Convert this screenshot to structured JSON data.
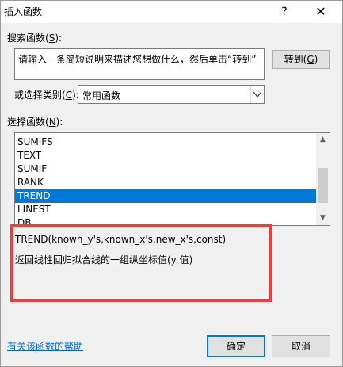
{
  "window": {
    "title": "插入函数",
    "help_icon": "question-mark-icon",
    "close_icon": "close-icon"
  },
  "search": {
    "label_prefix": "搜索函数(",
    "label_key": "S",
    "label_suffix": "):",
    "value": "请输入一条简短说明来描述您想做什么，然后单击“转到”",
    "go_prefix": "转到(",
    "go_key": "G",
    "go_suffix": ")"
  },
  "category": {
    "label_prefix": "或选择类别(",
    "label_key": "C",
    "label_suffix": "):",
    "selected": "常用函数",
    "arrow_icon": "chevron-down-icon"
  },
  "functions": {
    "label_prefix": "选择函数(",
    "label_key": "N",
    "label_suffix": "):",
    "items": [
      "SUMIFS",
      "TEXT",
      "SUMIF",
      "RANK",
      "TREND",
      "LINEST",
      "DB"
    ],
    "selected_index": 4
  },
  "description": {
    "syntax": "TREND(known_y's,known_x's,new_x's,const)",
    "text": "返回线性回归拟合线的一组纵坐标值(y 值)"
  },
  "footer": {
    "help_link": "有关该函数的帮助",
    "ok": "确定",
    "cancel": "取消"
  },
  "colors": {
    "selection": "#0078d7",
    "highlight_frame": "#e8403e",
    "link": "#0066cc"
  }
}
